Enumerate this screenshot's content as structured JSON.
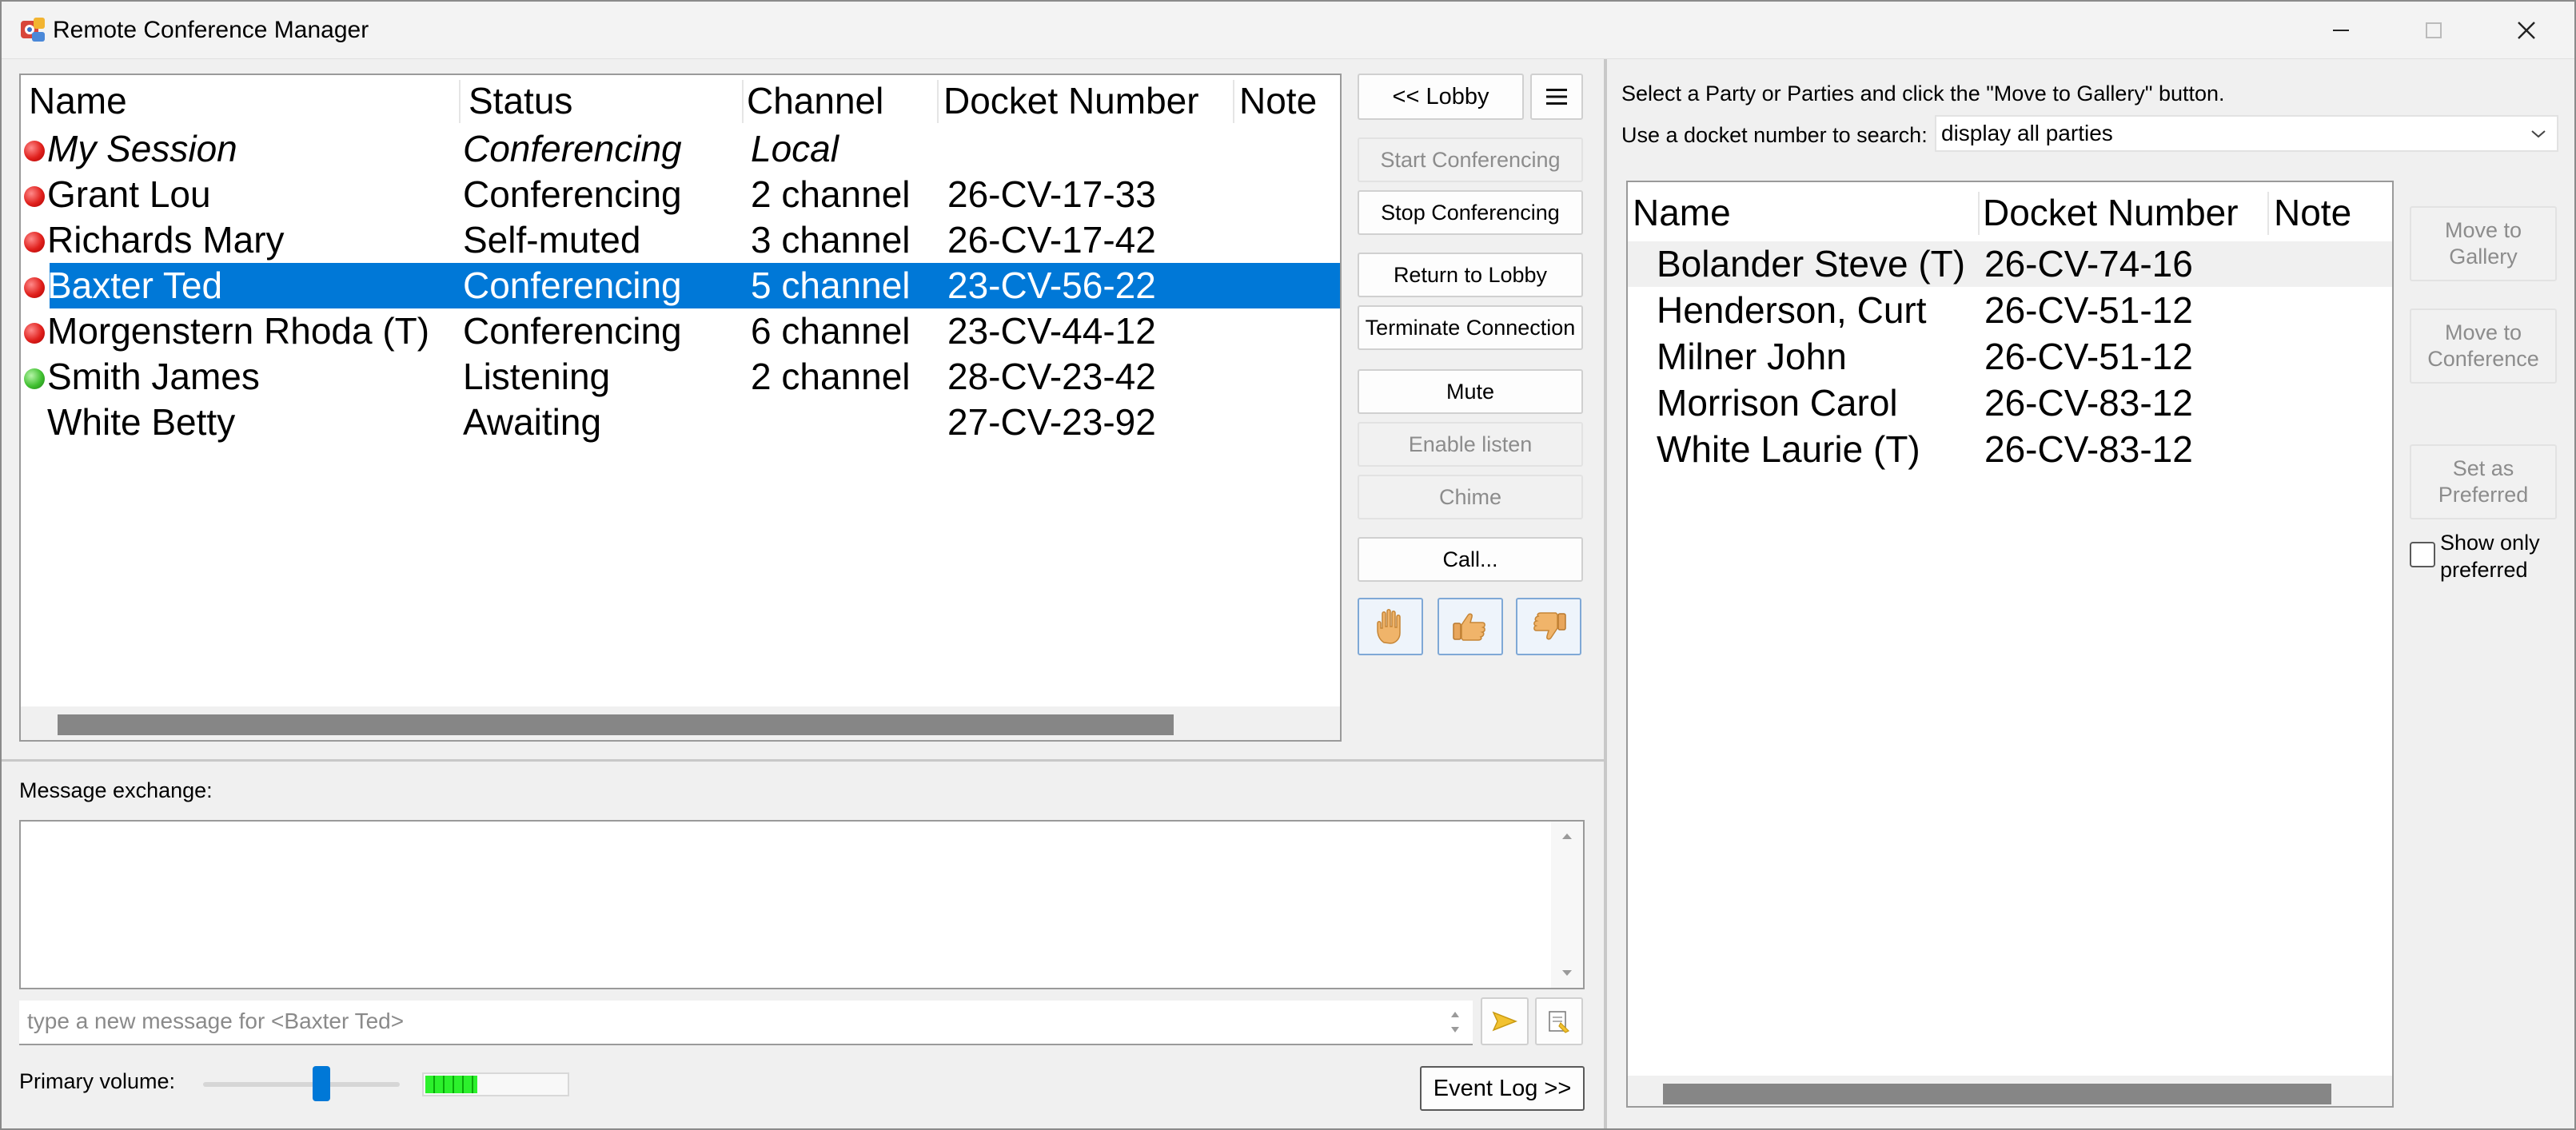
{
  "window": {
    "title": "Remote Conference Manager",
    "icon": "conference-app-icon",
    "controls": [
      "minimize-icon",
      "maximize-icon",
      "close-icon"
    ]
  },
  "conference": {
    "columns": [
      "Name",
      "Status",
      "Channel",
      "Docket Number",
      "Note"
    ],
    "rows": [
      {
        "indicator": "red",
        "name": "My Session",
        "status": "Conferencing",
        "channel": "Local",
        "docket": "",
        "note": "",
        "italic": true,
        "selected": false
      },
      {
        "indicator": "red",
        "name": "Grant Lou",
        "status": "Conferencing",
        "channel": "2 channel",
        "docket": "26-CV-17-33",
        "note": "",
        "italic": false,
        "selected": false
      },
      {
        "indicator": "red",
        "name": "Richards Mary",
        "status": "Self-muted",
        "channel": "3 channel",
        "docket": "26-CV-17-42",
        "note": "",
        "italic": false,
        "selected": false
      },
      {
        "indicator": "red",
        "name": "Baxter Ted",
        "status": "Conferencing",
        "channel": "5 channel",
        "docket": "23-CV-56-22",
        "note": "",
        "italic": false,
        "selected": true
      },
      {
        "indicator": "red",
        "name": "Morgenstern Rhoda (T)",
        "status": "Conferencing",
        "channel": "6 channel",
        "docket": "23-CV-44-12",
        "note": "",
        "italic": false,
        "selected": false
      },
      {
        "indicator": "green",
        "name": "Smith James",
        "status": "Listening",
        "channel": "2 channel",
        "docket": "28-CV-23-42",
        "note": "",
        "italic": false,
        "selected": false
      },
      {
        "indicator": "none",
        "name": "White Betty",
        "status": "Awaiting",
        "channel": "",
        "docket": "27-CV-23-92",
        "note": "",
        "italic": false,
        "selected": false
      }
    ]
  },
  "controls": {
    "lobby": "<< Lobby",
    "menu_icon": "hamburger-menu-icon",
    "start_conferencing": "Start Conferencing",
    "stop_conferencing": "Stop Conferencing",
    "return_to_lobby": "Return to Lobby",
    "terminate_connection": "Terminate Connection",
    "mute": "Mute",
    "enable_listen": "Enable listen",
    "chime": "Chime",
    "call": "Call...",
    "gesture_icons": [
      "raised-hand-icon",
      "thumbs-up-icon",
      "thumbs-down-icon"
    ]
  },
  "messages": {
    "label": "Message exchange:",
    "placeholder": "type a new message for <Baxter Ted>",
    "send_icon": "send-icon",
    "attach_icon": "attach-note-icon"
  },
  "volume": {
    "label": "Primary volume:",
    "level": 0.6,
    "meter_level": 0.36,
    "event_log": "Event Log >>"
  },
  "gallery": {
    "instructions": "Select a Party or Parties and click the \"Move to Gallery\" button.",
    "search_label": "Use a docket number to search:",
    "search_value": "display all parties",
    "columns": [
      "Name",
      "Docket Number",
      "Note"
    ],
    "rows": [
      {
        "name": "Bolander Steve (T)",
        "docket": "26-CV-74-16",
        "note": "",
        "highlighted": true
      },
      {
        "name": "Henderson, Curt",
        "docket": "26-CV-51-12",
        "note": "",
        "highlighted": false
      },
      {
        "name": "Milner John",
        "docket": "26-CV-51-12",
        "note": "",
        "highlighted": false
      },
      {
        "name": "Morrison Carol",
        "docket": "26-CV-83-12",
        "note": "",
        "highlighted": false
      },
      {
        "name": "White Laurie (T)",
        "docket": "26-CV-83-12",
        "note": "",
        "highlighted": false
      }
    ],
    "move_to_gallery": "Move to Gallery",
    "move_to_conference": "Move to Conference",
    "set_as_preferred": "Set as Preferred",
    "show_only_preferred": "Show only preferred"
  },
  "colors": {
    "selection": "#0078d7",
    "status_red": "#e0201c",
    "status_green": "#40c030"
  }
}
